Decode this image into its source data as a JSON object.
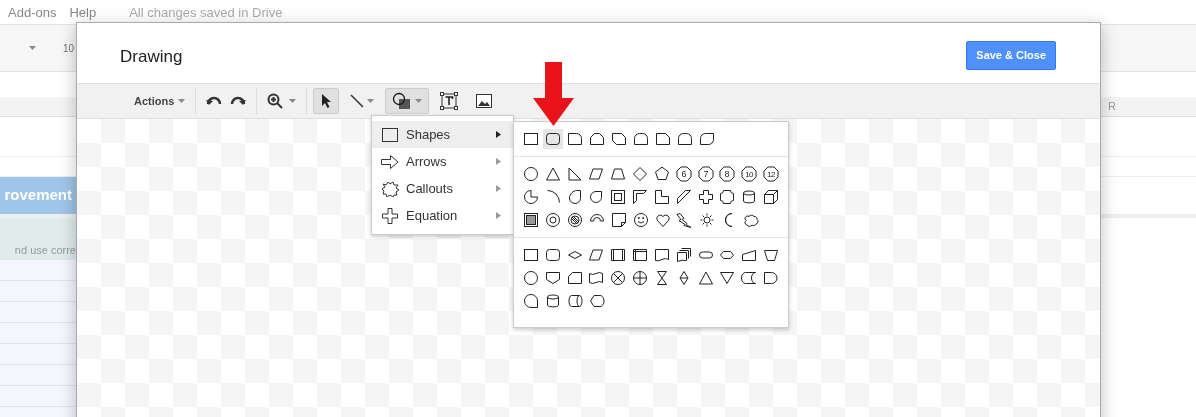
{
  "sheet": {
    "menu": [
      "Add-ons",
      "Help",
      "All changes saved in Drive"
    ],
    "toolbar_fragment": "10",
    "column_header": "R",
    "header_cell": "rovement",
    "text_cell": "nd use corre"
  },
  "dialog": {
    "title": "Drawing",
    "save_button": "Save & Close",
    "toolbar": {
      "actions": "Actions",
      "tools": [
        {
          "kind": "select",
          "selected": true
        },
        {
          "kind": "line",
          "selected": false
        },
        {
          "kind": "shape",
          "selected": true
        },
        {
          "kind": "textbox",
          "selected": false
        },
        {
          "kind": "image",
          "selected": false
        }
      ]
    },
    "menu": [
      {
        "kind": "shapes",
        "label": "Shapes",
        "selected": true
      },
      {
        "kind": "arrows",
        "label": "Arrows",
        "selected": false
      },
      {
        "kind": "callouts",
        "label": "Callouts",
        "selected": false
      },
      {
        "kind": "equation",
        "label": "Equation",
        "selected": false
      }
    ],
    "shape_sections": [
      {
        "rows": [
          [
            {
              "kind": "rect",
              "selected": false
            },
            {
              "kind": "round-rect",
              "selected": true
            },
            {
              "kind": "round-corner",
              "selected": false
            },
            {
              "kind": "snip-top",
              "selected": false
            },
            {
              "kind": "snip-diag",
              "selected": false
            },
            {
              "kind": "round-top",
              "selected": false
            },
            {
              "kind": "snip-corner",
              "selected": false
            },
            {
              "kind": "round-top",
              "selected": false
            },
            {
              "kind": "round-diag",
              "selected": false
            }
          ]
        ]
      },
      {
        "rows": [
          [
            {
              "kind": "ellipse",
              "selected": false
            },
            {
              "kind": "triangle",
              "selected": false
            },
            {
              "kind": "right-triangle",
              "selected": false
            },
            {
              "kind": "parallelogram",
              "selected": false
            },
            {
              "kind": "trapezoid",
              "selected": false
            },
            {
              "kind": "diamond",
              "selected": false
            },
            {
              "kind": "pentagon",
              "selected": false
            },
            {
              "kind": "polygon",
              "label": "6",
              "selected": false
            },
            {
              "kind": "polygon",
              "label": "7",
              "selected": false
            },
            {
              "kind": "polygon",
              "label": "8",
              "selected": false
            },
            {
              "kind": "polygon",
              "label": "10",
              "selected": false
            },
            {
              "kind": "polygon",
              "label": "12",
              "selected": false
            }
          ],
          [
            {
              "kind": "pie",
              "selected": false
            },
            {
              "kind": "arc",
              "selected": false
            },
            {
              "kind": "teardrop",
              "selected": false
            },
            {
              "kind": "chord",
              "selected": false
            },
            {
              "kind": "frame",
              "selected": false
            },
            {
              "kind": "half-frame",
              "selected": false
            },
            {
              "kind": "l-shape",
              "selected": false
            },
            {
              "kind": "stripe",
              "selected": false
            },
            {
              "kind": "plus",
              "selected": false
            },
            {
              "kind": "plaque",
              "selected": false
            },
            {
              "kind": "can",
              "selected": false
            },
            {
              "kind": "cube",
              "selected": false
            }
          ],
          [
            {
              "kind": "bevel",
              "selected": false
            },
            {
              "kind": "donut",
              "selected": false
            },
            {
              "kind": "no-symbol",
              "selected": false
            },
            {
              "kind": "block-arc",
              "selected": false
            },
            {
              "kind": "folded",
              "selected": false
            },
            {
              "kind": "smiley",
              "selected": false
            },
            {
              "kind": "heart",
              "selected": false
            },
            {
              "kind": "lightning",
              "selected": false
            },
            {
              "kind": "sun",
              "selected": false
            },
            {
              "kind": "moon",
              "selected": false
            },
            {
              "kind": "cloud",
              "selected": false
            }
          ]
        ]
      },
      {
        "rows": [
          [
            {
              "kind": "rect",
              "selected": false
            },
            {
              "kind": "round-rect",
              "selected": false
            },
            {
              "kind": "flat-diamond",
              "selected": false
            },
            {
              "kind": "parallelogram",
              "selected": false
            },
            {
              "kind": "predefined",
              "selected": false
            },
            {
              "kind": "internal-storage",
              "selected": false
            },
            {
              "kind": "document",
              "selected": false
            },
            {
              "kind": "multidoc",
              "selected": false
            },
            {
              "kind": "terminator",
              "selected": false
            },
            {
              "kind": "preparation",
              "selected": false
            },
            {
              "kind": "manual-input",
              "selected": false
            },
            {
              "kind": "manual-op",
              "selected": false
            }
          ],
          [
            {
              "kind": "ellipse",
              "selected": false
            },
            {
              "kind": "offpage",
              "selected": false
            },
            {
              "kind": "card",
              "selected": false
            },
            {
              "kind": "tape",
              "selected": false
            },
            {
              "kind": "summing",
              "selected": false
            },
            {
              "kind": "or",
              "selected": false
            },
            {
              "kind": "collate",
              "selected": false
            },
            {
              "kind": "sort",
              "selected": false
            },
            {
              "kind": "triangle",
              "selected": false
            },
            {
              "kind": "merge",
              "selected": false
            },
            {
              "kind": "stored-data",
              "selected": false
            },
            {
              "kind": "delay",
              "selected": false
            }
          ],
          [
            {
              "kind": "sequential",
              "selected": false
            },
            {
              "kind": "can",
              "selected": false
            },
            {
              "kind": "direct-access",
              "selected": false
            },
            {
              "kind": "display",
              "selected": false
            }
          ]
        ]
      }
    ]
  }
}
